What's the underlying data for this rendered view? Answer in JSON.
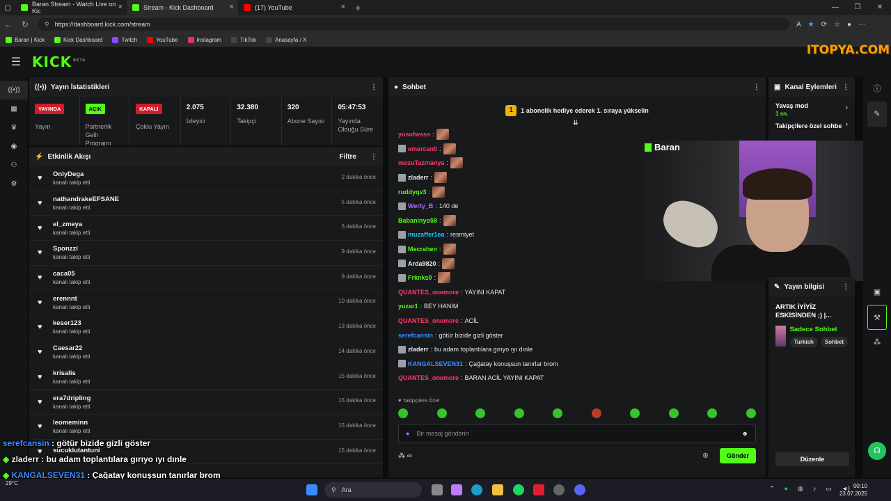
{
  "browser": {
    "tabs": [
      {
        "title": "Baran Stream - Watch Live on Kic",
        "color": "#53fc18",
        "active": false
      },
      {
        "title": "Stream - Kick Dashboard",
        "color": "#53fc18",
        "active": true
      },
      {
        "title": "(17) YouTube",
        "color": "#ff0000",
        "active": false
      }
    ],
    "url": "https://dashboard.kick.com/stream",
    "bookmarks": [
      {
        "label": "Baran | Kick",
        "color": "#53fc18"
      },
      {
        "label": "Kick Dashboard",
        "color": "#53fc18"
      },
      {
        "label": "Twitch",
        "color": "#9146ff"
      },
      {
        "label": "YouTube",
        "color": "#ff0000"
      },
      {
        "label": "Instagram",
        "color": "#e1306c"
      },
      {
        "label": "TikTok",
        "color": "#222222"
      },
      {
        "label": "Anasayfa / X",
        "color": "#222222"
      }
    ]
  },
  "header": {
    "logo": "KICK",
    "logo_sup": "BETA",
    "watermark": "ITOPYA.COM"
  },
  "stats_panel": {
    "title": "Yayın İstatistikleri",
    "items": [
      {
        "badge": "YAYINDA",
        "label": "Yayın"
      },
      {
        "badge": "AÇIK",
        "label": "Partnerlik Gelir Programı"
      },
      {
        "badge": "KAPALI",
        "label": "Çoklu Yayın"
      },
      {
        "value": "2.075",
        "label": "İzleyici"
      },
      {
        "value": "32.380",
        "label": "Takipçi"
      },
      {
        "value": "320",
        "label": "Abone Sayısı"
      },
      {
        "value": "05:47:53",
        "label": "Yayında Olduğu Süre"
      }
    ]
  },
  "activity": {
    "title": "Etkinlik Akışı",
    "filter": "Filtre",
    "items": [
      {
        "name": "OnlyDega",
        "sub": "kanalı takip etti",
        "time": "2 dakika önce"
      },
      {
        "name": "nathandrakeEFSANE",
        "sub": "kanalı takip etti",
        "time": "5 dakika önce"
      },
      {
        "name": "el_zmeya",
        "sub": "kanalı takip etti",
        "time": "6 dakika önce"
      },
      {
        "name": "Sponzzi",
        "sub": "kanalı takip etti",
        "time": "9 dakika önce"
      },
      {
        "name": "caca05",
        "sub": "kanalı takip etti",
        "time": "9 dakika önce"
      },
      {
        "name": "erennnt",
        "sub": "kanalı takip etti",
        "time": "10 dakika önce"
      },
      {
        "name": "keser123",
        "sub": "kanalı takip etti",
        "time": "13 dakika önce"
      },
      {
        "name": "Caesar22",
        "sub": "kanalı takip etti",
        "time": "14 dakika önce"
      },
      {
        "name": "krisalis",
        "sub": "kanalı takip etti",
        "time": "15 dakika önce"
      },
      {
        "name": "era7dripling",
        "sub": "kanalı takip etti",
        "time": "15 dakika önce"
      },
      {
        "name": "leomeminn",
        "sub": "kanalı takip etti",
        "time": "15 dakika önce"
      },
      {
        "name": "sucuklutantuni",
        "sub": "",
        "time": "15 dakika önce"
      }
    ]
  },
  "chat": {
    "title": "Sohbet",
    "gift_text": "1 abonelik hediye ederek 1. sıraya yükselin",
    "gift_rank": "1",
    "lines": [
      {
        "user": "yusufwsss",
        "color": "#ff3a6b",
        "msg": "",
        "emote": true,
        "avatar": false
      },
      {
        "user": "emercan0",
        "color": "#ff3a6b",
        "msg": "",
        "emote": true,
        "avatar": true
      },
      {
        "user": "mesuTazmanya",
        "color": "#ff3a6b",
        "msg": "",
        "emote": true,
        "avatar": false
      },
      {
        "user": "zladerr",
        "color": "#e6e6e6",
        "msg": "",
        "emote": true,
        "avatar": true
      },
      {
        "user": "ruddyqv3",
        "color": "#53fc18",
        "msg": "",
        "emote": true,
        "avatar": false
      },
      {
        "user": "Werty_B",
        "color": "#a970ff",
        "msg": "140 de",
        "emote": false,
        "avatar": true
      },
      {
        "user": "Babaninyo58",
        "color": "#53fc18",
        "msg": "",
        "emote": true,
        "avatar": false
      },
      {
        "user": "muzaffer1ea",
        "color": "#1ec8ff",
        "msg": "resmiyet",
        "emote": false,
        "avatar": true
      },
      {
        "user": "Mecrahen",
        "color": "#53fc18",
        "msg": "",
        "emote": true,
        "avatar": true
      },
      {
        "user": "Arda9820",
        "color": "#e6e6e6",
        "msg": "",
        "emote": true,
        "avatar": true
      },
      {
        "user": "Frknks0",
        "color": "#53fc18",
        "msg": "",
        "emote": true,
        "avatar": true
      },
      {
        "user": "QUANTES_onemore",
        "color": "#ff3a6b",
        "msg": "YAYINI KAPAT",
        "emote": false,
        "avatar": false
      },
      {
        "user": "yuzar1",
        "color": "#53fc18",
        "msg": "BEY HANIM",
        "emote": false,
        "avatar": false
      },
      {
        "user": "QUANTES_onemore",
        "color": "#ff3a6b",
        "msg": "ACİL",
        "emote": false,
        "avatar": false
      },
      {
        "user": "serefcansin",
        "color": "#3b8bff",
        "msg": "götür bizide gizli göster",
        "emote": false,
        "avatar": false
      },
      {
        "user": "zladerr",
        "color": "#e6e6e6",
        "msg": "bu adam toplantılara gırıyo ıyı dınle",
        "emote": false,
        "avatar": true
      },
      {
        "user": "KANGALSEVEN31",
        "color": "#3b8bff",
        "msg": "Çağatay konuşsun tanırlar brom",
        "emote": false,
        "avatar": true
      },
      {
        "user": "QUANTES_onemore",
        "color": "#ff3a6b",
        "msg": "BARAN ACİL YAYINI KAPAT",
        "emote": false,
        "avatar": false
      }
    ],
    "followers_only": "Takipçilere Özel",
    "input_placeholder": "Bir mesaj gönderin",
    "send": "Gönder"
  },
  "cam": {
    "name": "Baran"
  },
  "channel": {
    "title": "Kanal Eylemleri",
    "slow_mode": "Yavaş mod",
    "slow_val": "1 sn.",
    "followers": "Takipçilere özel sohbe"
  },
  "stream_info": {
    "title": "Yayın bilgisi",
    "stream_title": "ARTIK İYİYİZ ESKİSİNDEN ;) |...",
    "category": "Sadece Sohbet",
    "tags": [
      "Turkish",
      "Sohbet"
    ],
    "edit": "Düzenle"
  },
  "overlay": [
    {
      "user": "serefcansin",
      "color": "#3b8bff",
      "msg": "götür bizide gizli göster"
    },
    {
      "user": "zladerr",
      "color": "#e6e6e6",
      "msg": "bu adam toplantılara gırıyo ıyı dınle"
    },
    {
      "user": "KANGALSEVEN31",
      "color": "#3b8bff",
      "msg": "Çağatay konuşsun tanırlar brom"
    },
    {
      "user": "QUANTES_onemore",
      "color": "#ff3a6b",
      "msg": "BARAN ACİL YAYINI KAPAT"
    }
  ],
  "taskbar": {
    "search": "Ara",
    "time": "00:10",
    "date": "23.07.2025",
    "weather": "29°C"
  }
}
